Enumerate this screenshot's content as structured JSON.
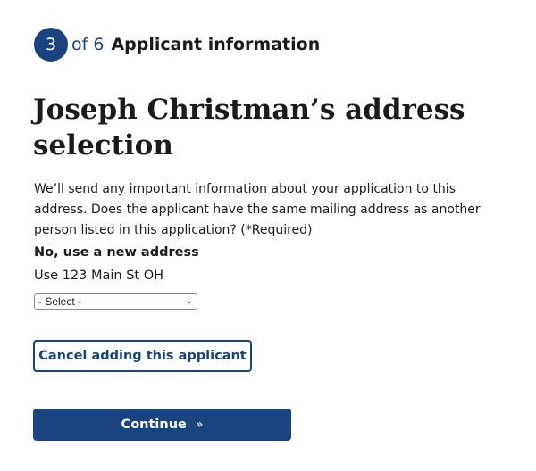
{
  "step": {
    "number": "3",
    "of_label": "of 6",
    "title": "Applicant information"
  },
  "page_title": "Joseph Christman’s address selection",
  "intro_text": "We’ll send any important information about your application to this address. Does the applicant have the same mailing address as another person listed in this application? (*Required)",
  "option": {
    "title": "No, use a new address",
    "subtitle": "Use 123 Main St OH"
  },
  "address_select": {
    "selected_value": "- Select -"
  },
  "buttons": {
    "cancel_label": "Cancel adding this applicant",
    "continue_label": "Continue",
    "continue_icon": "»"
  },
  "colors": {
    "primary": "#1a4480",
    "text": "#1b1b1b",
    "background": "#ffffff"
  }
}
